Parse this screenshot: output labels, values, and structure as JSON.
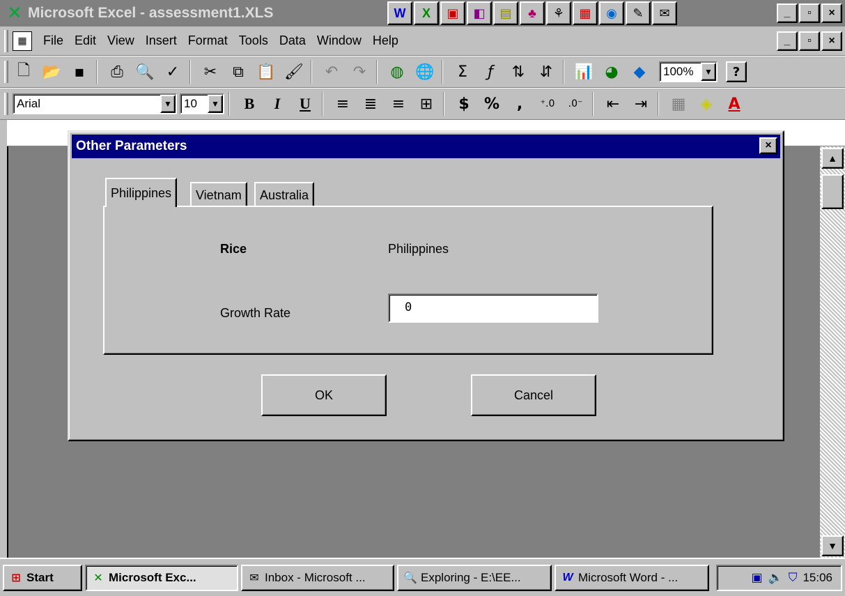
{
  "window": {
    "title": "Microsoft Excel - assessment1.XLS",
    "controls": {
      "minimize": "_",
      "maximize": "▫",
      "close": "×"
    }
  },
  "office_bar": [
    "W",
    "X",
    "▣",
    "◧",
    "▤",
    "♣",
    "⚘",
    "▦",
    "◉",
    "✎",
    "✉"
  ],
  "menu": {
    "items": [
      "File",
      "Edit",
      "View",
      "Insert",
      "Format",
      "Tools",
      "Data",
      "Window",
      "Help"
    ]
  },
  "standard_toolbar": {
    "zoom": "100%",
    "buttons": [
      "new-icon",
      "open-icon",
      "save-icon",
      "print-icon",
      "print-preview-icon",
      "spelling-icon",
      "cut-icon",
      "copy-icon",
      "paste-icon",
      "format-painter-icon",
      "undo-icon",
      "redo-icon",
      "web-icon",
      "hyperlink-icon",
      "autosum-icon",
      "function-icon",
      "sort-ascending-icon",
      "sort-descending-icon",
      "chart-wizard-icon",
      "map-icon",
      "drawing-icon",
      "help-icon"
    ]
  },
  "format_toolbar": {
    "font": "Arial",
    "size": "10",
    "bold": "B",
    "italic": "I",
    "underline": "U",
    "currency": "$",
    "percent": "%",
    "comma": ","
  },
  "dialog": {
    "title": "Other Parameters",
    "close": "×",
    "tabs": [
      "Philippines",
      "Vietnam",
      "Australia"
    ],
    "active_tab": "Philippines",
    "commodity_label": "Rice",
    "country_value": "Philippines",
    "growth_rate_label": "Growth Rate",
    "growth_rate_value": "0",
    "ok_label": "OK",
    "cancel_label": "Cancel"
  },
  "taskbar": {
    "start": "Start",
    "tasks": [
      "Microsoft Exc...",
      "Inbox - Microsoft ...",
      "Exploring - E:\\EE...",
      "Microsoft Word - ..."
    ],
    "clock": "15:06"
  },
  "colors": {
    "face": "#c0c0c0",
    "active_title": "#000080",
    "inactive_title": "#808080"
  }
}
